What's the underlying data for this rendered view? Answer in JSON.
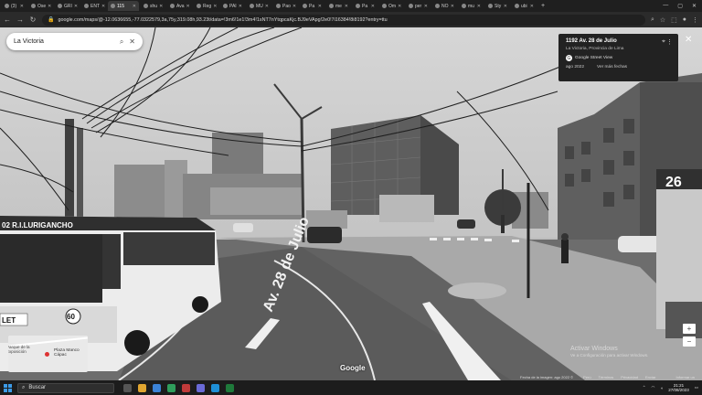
{
  "browser": {
    "tabs": [
      {
        "label": "(3)"
      },
      {
        "label": "Ose"
      },
      {
        "label": "GRI"
      },
      {
        "label": "ENT"
      },
      {
        "label": "115",
        "active": true
      },
      {
        "label": "shu"
      },
      {
        "label": "Ava"
      },
      {
        "label": "Reg"
      },
      {
        "label": "PAI"
      },
      {
        "label": "MU"
      },
      {
        "label": "Pao"
      },
      {
        "label": "Pa"
      },
      {
        "label": "me"
      },
      {
        "label": "Pa"
      },
      {
        "label": "Om"
      },
      {
        "label": "per"
      },
      {
        "label": "NO"
      },
      {
        "label": "mu"
      },
      {
        "label": "Sty"
      },
      {
        "label": "ubi"
      }
    ],
    "url": "google.com/maps/@-12.0636655,-77.0322579,3a,75y,319.08h,93.23t/data=!3m6!1e1!3m4!1sNT7nYtqpcaKjc.BJ9eVApg!2e0!7i16384!8i8192?entry=ttu"
  },
  "maps": {
    "search_value": "La Victoria",
    "info_card": {
      "address": "1192 Av. 28 de Julio",
      "locality": "La Victoria, Provincia de Lima",
      "source": "Google Street View",
      "date": "ago 2022",
      "more_dates": "Ver más fechas"
    },
    "minimap": {
      "label_left": "Parque de la Exposición",
      "label_right": "Plaza Manco Cápac"
    },
    "road_label": "Av. 28 de Julio",
    "bus_sign": "02  R.I.LURIGANCHO",
    "bus_number": "60",
    "bus_plate": "LET",
    "billboard_number": "26",
    "google_logo": "Google",
    "footer": [
      "Fecha de la imagen: ago 2022 © 2023 Google",
      "Perú",
      "Términos",
      "Privacidad",
      "Enviar comentarios",
      "Informar un problema"
    ],
    "activate_title": "Activar Windows",
    "activate_sub": "Ve a Configuración para activar Windows."
  },
  "taskbar": {
    "search_label": "Buscar",
    "time": "21:21",
    "date": "27/08/2023"
  }
}
